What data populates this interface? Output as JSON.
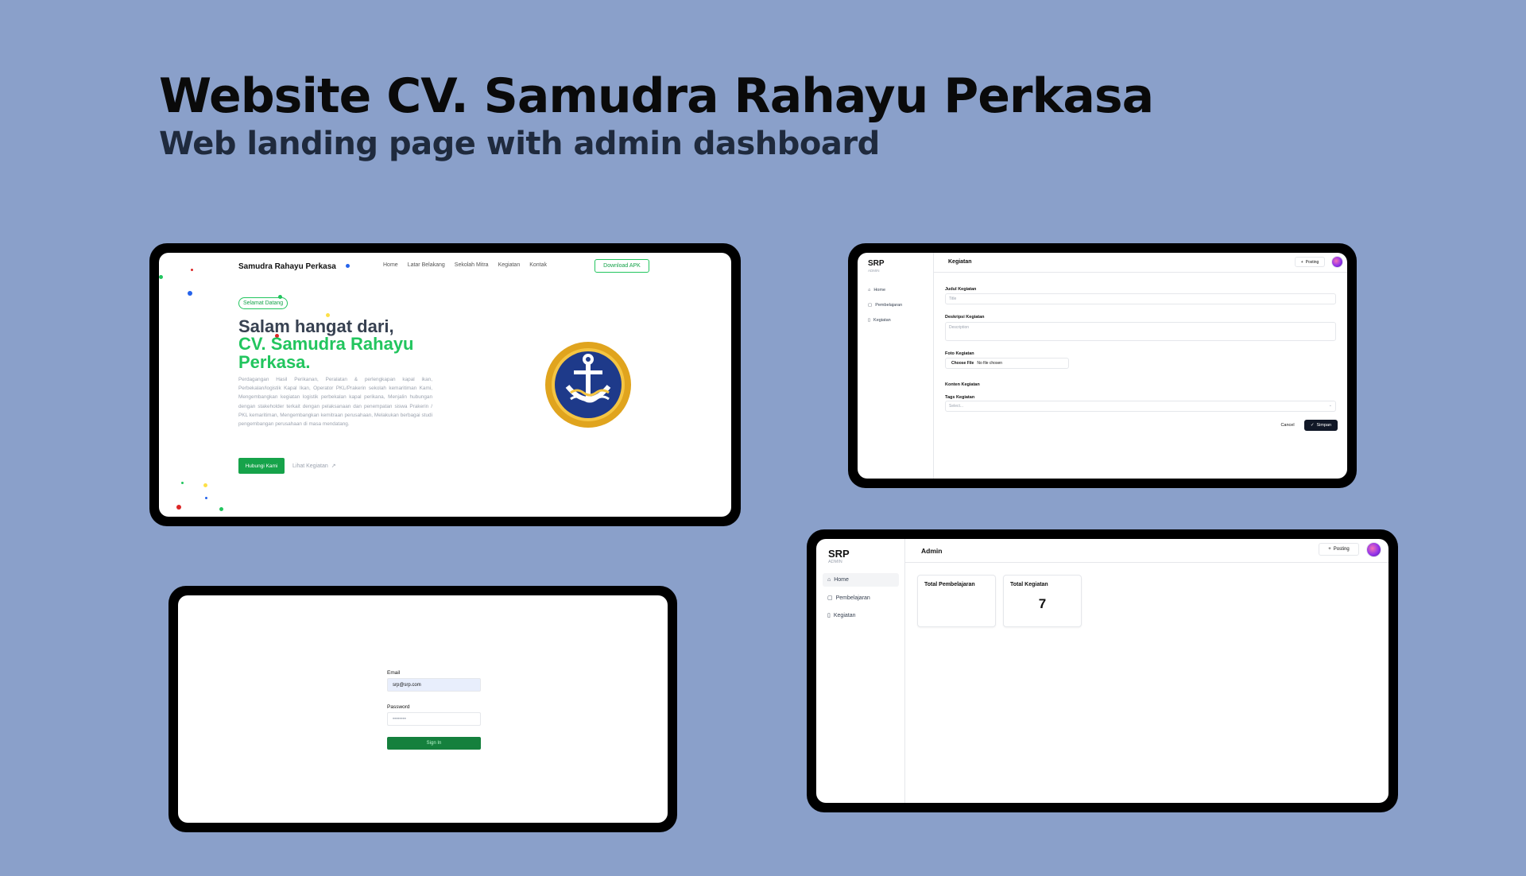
{
  "hero": {
    "title": "Website CV. Samudra Rahayu Perkasa",
    "subtitle": "Web landing page with admin dashboard"
  },
  "landing": {
    "brand": "Samudra Rahayu Perkasa",
    "nav": [
      "Home",
      "Latar Belakang",
      "Sekolah Mitra",
      "Kegiatan",
      "Kontak"
    ],
    "download_label": "Download APK",
    "badge": "Selamat Datang",
    "heading_line1": "Salam hangat dari,",
    "heading_line2": "CV. Samudra Rahayu Perkasa.",
    "paragraph": "Perdagangan Hasil Perikanan, Peralatan & perlengkapan kapal ikan, Perbekalan/logistik Kapal Ikan, Operator PKL/Prakerin sekolah kemaritiman Kami, Mengembangkan kegiatan logistik perbekalan kapal perikana, Menjalin hubungan dengan stakeholder terkait dengan pelaksanaan dan penempatan siswa Prakerin / PKL kemaritiman, Mengembangkan kemitraan perusahaan, Melakukan berbagai studi pengembangan perusahaan di masa mendatang.",
    "primary_button": "Hubungi Kami",
    "secondary_link": "Lihat Kegiatan",
    "secondary_icon": "arrow-up-right-icon",
    "logo_icon": "anchor-logo-icon",
    "accent": "#22c55e"
  },
  "form_screen": {
    "brand": "SRP",
    "brand_sub": "ADMIN",
    "sidebar": [
      {
        "label": "Home",
        "icon": "home-icon"
      },
      {
        "label": "Pembelajaran",
        "icon": "book-icon"
      },
      {
        "label": "Kegiatan",
        "icon": "file-icon"
      }
    ],
    "page_title": "Kegiatan",
    "posting_label": "Posting",
    "fields": {
      "title_label": "Judul Kegiatan",
      "title_placeholder": "Title",
      "desc_label": "Deskripsi Kegiatan",
      "desc_placeholder": "Description",
      "photo_label": "Foto Kegiatan",
      "file_button": "Choose File",
      "file_status": "No file chosen",
      "content_label": "Konten Kegiatan",
      "tags_label": "Tags Kegiatan",
      "tags_placeholder": "Select..."
    },
    "cancel_label": "Cancel",
    "save_label": "Simpan"
  },
  "login": {
    "email_label": "Email",
    "email_value": "srp@srp.com",
    "password_label": "Password",
    "password_value": "••••••••",
    "submit_label": "Sign In"
  },
  "admin": {
    "brand": "SRP",
    "brand_sub": "ADMIN",
    "sidebar": [
      {
        "label": "Home",
        "icon": "home-icon"
      },
      {
        "label": "Pembelajaran",
        "icon": "book-icon"
      },
      {
        "label": "Kegiatan",
        "icon": "file-icon"
      }
    ],
    "page_title": "Admin",
    "posting_label": "Posting",
    "cards": [
      {
        "title": "Total Pembelajaran",
        "value": ""
      },
      {
        "title": "Total Kegiatan",
        "value": "7"
      }
    ]
  }
}
